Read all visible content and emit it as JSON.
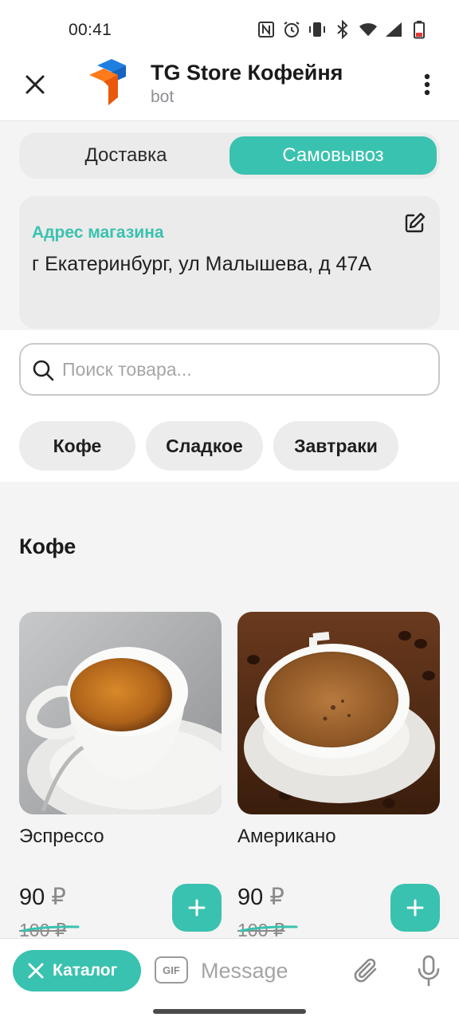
{
  "status_bar": {
    "time": "00:41",
    "icons": [
      "nfc-icon",
      "alarm-icon",
      "vibrate-icon",
      "bluetooth-icon",
      "wifi-icon",
      "signal-icon",
      "battery-icon"
    ]
  },
  "header": {
    "title": "TG Store Кофейня",
    "subtitle": "bot",
    "accent_color": "#39c2af"
  },
  "delivery_toggle": {
    "options": [
      "Доставка",
      "Самовывоз"
    ],
    "selected": "Самовывоз"
  },
  "address": {
    "label": "Адрес магазина",
    "value": "г Екатеринбург, ул Малышева, д 47А"
  },
  "search": {
    "placeholder": "Поиск товара..."
  },
  "categories": [
    "Кофе",
    "Сладкое",
    "Завтраки"
  ],
  "section": {
    "title": "Кофе"
  },
  "products": [
    {
      "name": "Эспрессо",
      "price": "90",
      "currency": "₽",
      "old_price": "100 ₽"
    },
    {
      "name": "Американо",
      "price": "90",
      "currency": "₽",
      "old_price": "100 ₽"
    }
  ],
  "composer": {
    "catalog_label": "Каталог",
    "gif_label": "GIF",
    "message_placeholder": "Message"
  }
}
